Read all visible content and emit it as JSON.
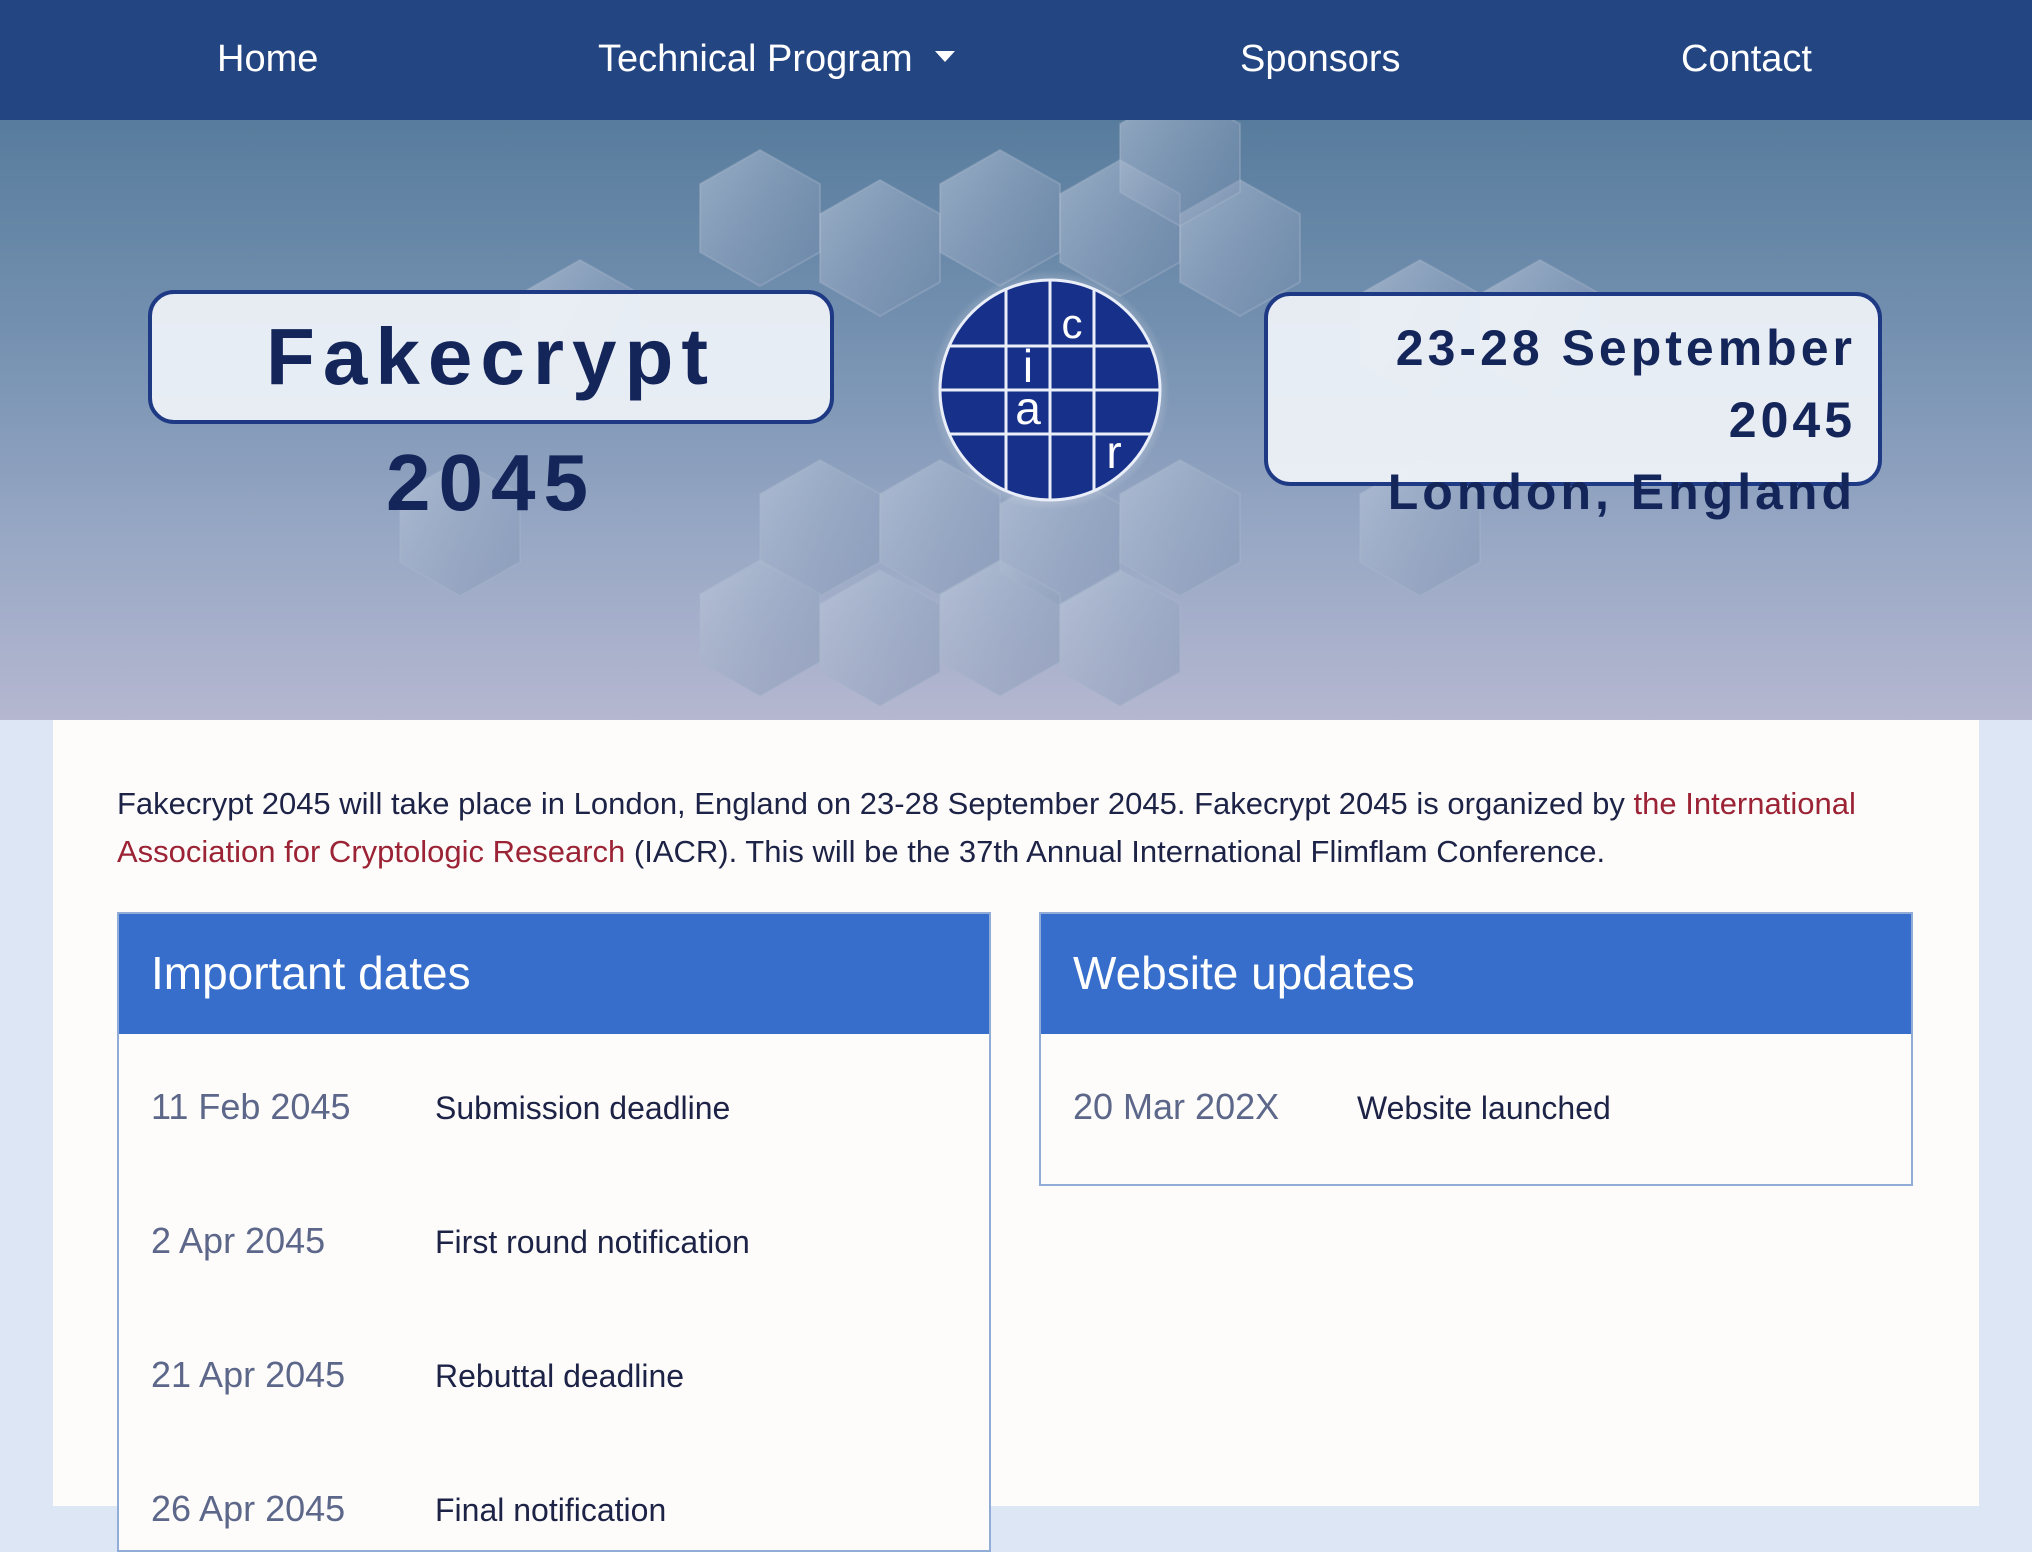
{
  "nav": {
    "items": [
      {
        "label": "Home"
      },
      {
        "label": "Technical Program"
      },
      {
        "label": "Sponsors"
      },
      {
        "label": "Contact"
      }
    ]
  },
  "hero": {
    "title": "Fakecrypt 2045",
    "dates": "23-28 September 2045",
    "location": "London, England",
    "logo_letters": [
      "c",
      "i",
      "a",
      "r"
    ]
  },
  "intro": {
    "text_before_link": "Fakecrypt 2045 will take place in London, England on 23-28 September 2045. Fakecrypt 2045 is organized by ",
    "link": "the International Association for Cryptologic Research",
    "text_after_link": " (IACR). This will be the 37th Annual International Flimflam Conference."
  },
  "important_dates": {
    "title": "Important dates",
    "rows": [
      {
        "date": "11 Feb 2045",
        "event": "Submission deadline"
      },
      {
        "date": "2 Apr 2045",
        "event": "First round notification"
      },
      {
        "date": "21 Apr 2045",
        "event": "Rebuttal deadline"
      },
      {
        "date": "26 Apr 2045",
        "event": "Final notification"
      }
    ]
  },
  "website_updates": {
    "title": "Website updates",
    "rows": [
      {
        "date": "20 Mar 202X",
        "event": "Website launched"
      }
    ]
  },
  "colors": {
    "nav_bg": "#234582",
    "card_header": "#376ecb",
    "link": "#9b2335",
    "logo_blue": "#17318a"
  }
}
